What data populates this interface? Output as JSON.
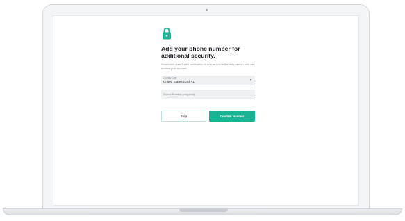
{
  "icons": {
    "lock": "lock-icon",
    "dropdown": "chevron-down-icon"
  },
  "colors": {
    "accent": "#1ab394",
    "heading": "#1a1d21",
    "field_bg": "#eef0f2"
  },
  "form": {
    "heading": "Add your phone number for additional security.",
    "subtext": "Sharecare uses 2-step verification to ensure you're the only person who can access your account.",
    "country_code": {
      "label": "Country Code",
      "value": "United States (US) +1"
    },
    "phone": {
      "placeholder": "Phone Number (required)",
      "value": ""
    },
    "skip_label": "Skip",
    "confirm_label": "Confirm Number"
  }
}
